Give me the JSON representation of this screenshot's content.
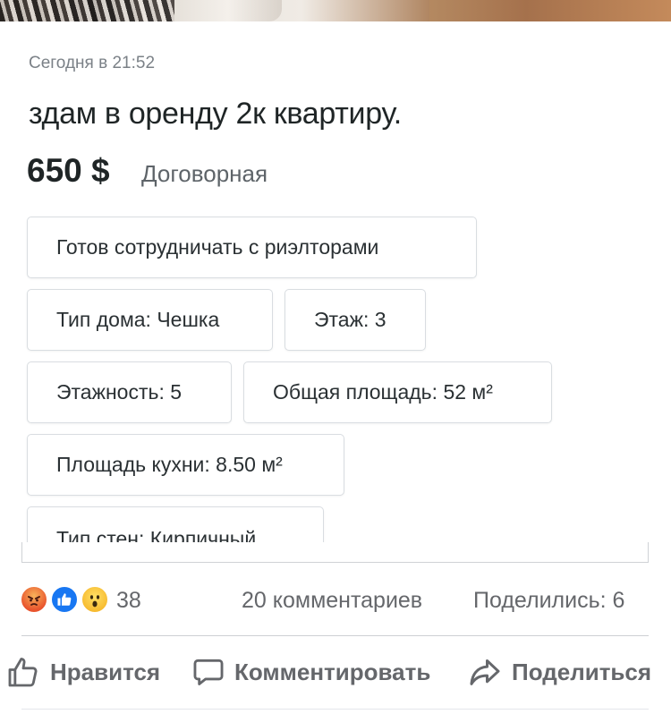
{
  "listing": {
    "date": "Сегодня в 21:52",
    "title": "здам в оренду 2к квартиру.",
    "price": "650 $",
    "price_note": "Договорная",
    "tags": [
      "Готов сотрудничать с риэлторами",
      "Тип дома: Чешка",
      "Этаж: 3",
      "Этажность: 5",
      "Общая площадь: 52 м²",
      "Площадь кухни: 8.50 м²",
      "Тип стен: Кирпичный"
    ]
  },
  "post_stats": {
    "reaction_icons": [
      "angry-reaction-icon",
      "like-reaction-icon",
      "wow-reaction-icon"
    ],
    "reaction_count": "38",
    "comments": "20 комментариев",
    "shares": "Поделились: 6"
  },
  "actions": {
    "like": "Нравится",
    "comment": "Комментировать",
    "share": "Поделиться"
  },
  "colors": {
    "like_blue": "#1877f2",
    "text_secondary": "#65676b",
    "tag_border": "#d9dde1"
  }
}
